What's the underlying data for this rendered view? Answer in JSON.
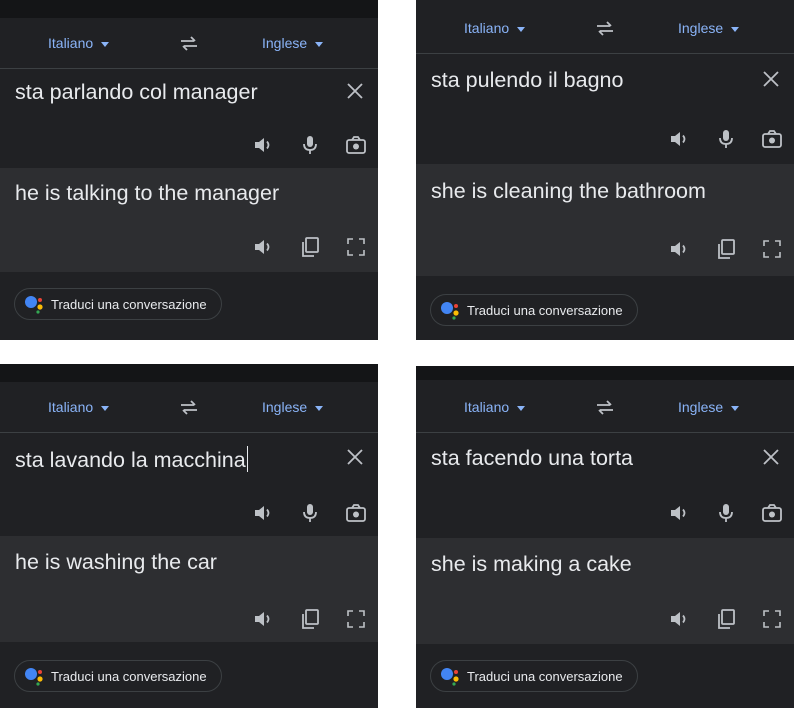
{
  "common": {
    "source_lang": "Italiano",
    "target_lang": "Inglese",
    "conversation_label": "Traduci una conversazione"
  },
  "panels": [
    {
      "source_text": "sta parlando col manager",
      "translation": "he is talking to the manager"
    },
    {
      "source_text": "sta pulendo il bagno",
      "translation": "she is cleaning the bathroom"
    },
    {
      "source_text": "sta lavando la macchina",
      "translation": "he is washing the car"
    },
    {
      "source_text": "sta facendo una torta",
      "translation": "she is making a cake"
    }
  ],
  "icons": {
    "swap": "swap-arrows-icon",
    "clear": "close-icon",
    "listen": "speaker-icon",
    "mic": "microphone-icon",
    "camera": "camera-icon",
    "copy": "copy-icon",
    "fullscreen": "fullscreen-icon",
    "assistant": "google-assistant-icon"
  },
  "colors": {
    "background": "#202124",
    "result_background": "#2d2e31",
    "accent": "#8ab4f8",
    "text": "#e8eaed",
    "icon": "#bdc1c6"
  }
}
